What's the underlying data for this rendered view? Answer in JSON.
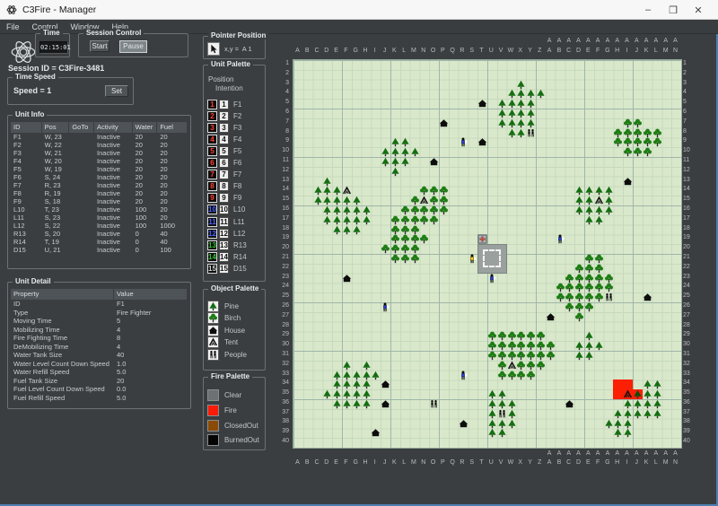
{
  "window": {
    "title": "C3Fire - Manager",
    "minimize": "–",
    "maximize": "❒",
    "close": "✕"
  },
  "menu": {
    "items": [
      "File",
      "Control",
      "Window",
      "Help"
    ]
  },
  "left": {
    "time": {
      "title": "Time",
      "value": "02:15:01"
    },
    "session_control": {
      "title": "Session Control",
      "start": "Start",
      "pause": "Pause"
    },
    "session_id": "Session ID = C3Fire-3481",
    "time_speed": {
      "title": "Time Speed",
      "label": "Speed = 1",
      "set": "Set"
    },
    "unit_info": {
      "title": "Unit Info",
      "columns": [
        "ID",
        "Pos",
        "GoTo",
        "Activity",
        "Water",
        "Fuel"
      ],
      "rows": [
        [
          "F1",
          "W, 23",
          "",
          "Inactive",
          "20",
          "20"
        ],
        [
          "F2",
          "W, 22",
          "",
          "Inactive",
          "20",
          "20"
        ],
        [
          "F3",
          "W, 21",
          "",
          "Inactive",
          "20",
          "20"
        ],
        [
          "F4",
          "W, 20",
          "",
          "Inactive",
          "20",
          "20"
        ],
        [
          "F5",
          "W, 19",
          "",
          "Inactive",
          "20",
          "20"
        ],
        [
          "F6",
          "S, 24",
          "",
          "Inactive",
          "20",
          "20"
        ],
        [
          "F7",
          "R, 23",
          "",
          "Inactive",
          "20",
          "20"
        ],
        [
          "F8",
          "R, 19",
          "",
          "Inactive",
          "20",
          "20"
        ],
        [
          "F9",
          "S, 18",
          "",
          "Inactive",
          "20",
          "20"
        ],
        [
          "L10",
          "T, 23",
          "",
          "Inactive",
          "100",
          "20"
        ],
        [
          "L11",
          "S, 23",
          "",
          "Inactive",
          "100",
          "20"
        ],
        [
          "L12",
          "S, 22",
          "",
          "Inactive",
          "100",
          "1000"
        ],
        [
          "R13",
          "S, 20",
          "",
          "Inactive",
          "0",
          "40"
        ],
        [
          "R14",
          "T, 19",
          "",
          "Inactive",
          "0",
          "40"
        ],
        [
          "D15",
          "U, 21",
          "",
          "Inactive",
          "0",
          "100"
        ]
      ]
    },
    "unit_detail": {
      "title": "Unit Detail",
      "columns": [
        "Property",
        "Value"
      ],
      "rows": [
        [
          "ID",
          "F1"
        ],
        [
          "Type",
          "Fire Fighter"
        ],
        [
          "Moving Time",
          "5"
        ],
        [
          "Mobilizing Time",
          "4"
        ],
        [
          "Fire Fighting Time",
          "8"
        ],
        [
          "DeMobilizing Time",
          "4"
        ],
        [
          "Water Tank Size",
          "40"
        ],
        [
          "Water Level Count Down Speed",
          "1.0"
        ],
        [
          "Water Refill Speed",
          "5.0"
        ],
        [
          "Fuel Tank Size",
          "20"
        ],
        [
          "Fuel Level Count Down Speed",
          "0.0"
        ],
        [
          "Fuel Refill Speed",
          "5.0"
        ]
      ]
    }
  },
  "middle": {
    "pointer": {
      "title": "Pointer Position",
      "value": "x,y =  A 1"
    },
    "unit_palette": {
      "title": "Unit Palette",
      "position_label": "Position",
      "intention_label": "Intention",
      "units": [
        {
          "num": "1",
          "label": "F1",
          "color": "#ff4033"
        },
        {
          "num": "2",
          "label": "F2",
          "color": "#ff4033"
        },
        {
          "num": "3",
          "label": "F3",
          "color": "#ff4033"
        },
        {
          "num": "4",
          "label": "F4",
          "color": "#ff4033"
        },
        {
          "num": "5",
          "label": "F5",
          "color": "#ff4033"
        },
        {
          "num": "6",
          "label": "F6",
          "color": "#ff4033"
        },
        {
          "num": "7",
          "label": "F7",
          "color": "#ff4033"
        },
        {
          "num": "8",
          "label": "F8",
          "color": "#ff4033"
        },
        {
          "num": "9",
          "label": "F9",
          "color": "#ff4033"
        },
        {
          "num": "10",
          "label": "L10",
          "color": "#4a63ff"
        },
        {
          "num": "11",
          "label": "L11",
          "color": "#4a63ff"
        },
        {
          "num": "12",
          "label": "L12",
          "color": "#4a63ff"
        },
        {
          "num": "13",
          "label": "R13",
          "color": "#35c335"
        },
        {
          "num": "14",
          "label": "R14",
          "color": "#35c335"
        },
        {
          "num": "15",
          "label": "D15",
          "color": "#cfd3d4"
        }
      ]
    },
    "object_palette": {
      "title": "Object Palette",
      "items": [
        {
          "icon": "pine",
          "label": "Pine"
        },
        {
          "icon": "birch",
          "label": "Birch"
        },
        {
          "icon": "house",
          "label": "House"
        },
        {
          "icon": "tent",
          "label": "Tent"
        },
        {
          "icon": "people",
          "label": "People"
        }
      ]
    },
    "fire_palette": {
      "title": "Fire Palette",
      "items": [
        {
          "label": "Clear",
          "color": "#6e7173"
        },
        {
          "label": "Fire",
          "color": "#fb1b07"
        },
        {
          "label": "ClosedOut",
          "color": "#8a4a08"
        },
        {
          "label": "BurnedOut",
          "color": "#040404"
        }
      ]
    }
  },
  "map": {
    "cols": 40,
    "rows": 40,
    "col_letters": [
      "A",
      "B",
      "C",
      "D",
      "E",
      "F",
      "G",
      "H",
      "I",
      "J",
      "K",
      "L",
      "M",
      "N",
      "O",
      "P",
      "Q",
      "R",
      "S",
      "T",
      "U",
      "V",
      "W",
      "X",
      "Y",
      "Z",
      "A",
      "B",
      "C",
      "D",
      "E",
      "F",
      "G",
      "H",
      "I",
      "J",
      "K",
      "L",
      "M",
      "N"
    ],
    "second_alphabet_prefix": "A",
    "second_alphabet_from": 27,
    "colors": {
      "bg": "#d9e8cb",
      "grid_minor": "#c6dabd",
      "grid_major": "#9fb6a8",
      "fire": "#fb1f03",
      "pine_green": "#156e12",
      "birch_green": "#1e7d14"
    },
    "pine": [
      [
        11,
        9
      ],
      [
        12,
        9
      ],
      [
        10,
        10
      ],
      [
        11,
        10
      ],
      [
        12,
        10
      ],
      [
        13,
        10
      ],
      [
        10,
        11
      ],
      [
        11,
        11
      ],
      [
        12,
        11
      ],
      [
        11,
        12
      ],
      [
        4,
        13
      ],
      [
        3,
        14
      ],
      [
        4,
        14
      ],
      [
        5,
        14
      ],
      [
        3,
        15
      ],
      [
        4,
        15
      ],
      [
        5,
        15
      ],
      [
        6,
        15
      ],
      [
        7,
        15
      ],
      [
        4,
        16
      ],
      [
        5,
        16
      ],
      [
        6,
        16
      ],
      [
        7,
        16
      ],
      [
        8,
        16
      ],
      [
        4,
        17
      ],
      [
        5,
        17
      ],
      [
        6,
        17
      ],
      [
        7,
        17
      ],
      [
        8,
        17
      ],
      [
        5,
        18
      ],
      [
        6,
        18
      ],
      [
        7,
        18
      ],
      [
        24,
        3
      ],
      [
        23,
        4
      ],
      [
        24,
        4
      ],
      [
        25,
        4
      ],
      [
        26,
        4
      ],
      [
        22,
        5
      ],
      [
        23,
        5
      ],
      [
        24,
        5
      ],
      [
        25,
        5
      ],
      [
        22,
        6
      ],
      [
        23,
        6
      ],
      [
        24,
        6
      ],
      [
        25,
        6
      ],
      [
        22,
        7
      ],
      [
        23,
        7
      ],
      [
        24,
        7
      ],
      [
        25,
        7
      ],
      [
        23,
        8
      ],
      [
        24,
        8
      ],
      [
        30,
        14
      ],
      [
        31,
        14
      ],
      [
        32,
        14
      ],
      [
        33,
        14
      ],
      [
        30,
        15
      ],
      [
        31,
        15
      ],
      [
        33,
        15
      ],
      [
        30,
        16
      ],
      [
        31,
        16
      ],
      [
        32,
        16
      ],
      [
        33,
        16
      ],
      [
        31,
        17
      ],
      [
        32,
        17
      ],
      [
        31,
        29
      ],
      [
        30,
        30
      ],
      [
        31,
        30
      ],
      [
        32,
        30
      ],
      [
        30,
        31
      ],
      [
        31,
        31
      ],
      [
        6,
        32
      ],
      [
        8,
        32
      ],
      [
        5,
        33
      ],
      [
        6,
        33
      ],
      [
        7,
        33
      ],
      [
        8,
        33
      ],
      [
        9,
        33
      ],
      [
        5,
        34
      ],
      [
        6,
        34
      ],
      [
        7,
        34
      ],
      [
        8,
        34
      ],
      [
        4,
        35
      ],
      [
        5,
        35
      ],
      [
        6,
        35
      ],
      [
        7,
        35
      ],
      [
        8,
        35
      ],
      [
        5,
        36
      ],
      [
        6,
        36
      ],
      [
        7,
        36
      ],
      [
        8,
        36
      ],
      [
        21,
        35
      ],
      [
        22,
        35
      ],
      [
        21,
        36
      ],
      [
        22,
        36
      ],
      [
        23,
        36
      ],
      [
        21,
        37
      ],
      [
        23,
        37
      ],
      [
        21,
        38
      ],
      [
        22,
        38
      ],
      [
        23,
        38
      ],
      [
        21,
        39
      ],
      [
        22,
        39
      ],
      [
        37,
        34
      ],
      [
        38,
        34
      ],
      [
        37,
        35
      ],
      [
        38,
        35
      ],
      [
        35,
        36
      ],
      [
        36,
        36
      ],
      [
        37,
        36
      ],
      [
        38,
        36
      ],
      [
        34,
        37
      ],
      [
        35,
        37
      ],
      [
        36,
        37
      ],
      [
        37,
        37
      ],
      [
        38,
        37
      ],
      [
        33,
        38
      ],
      [
        34,
        38
      ],
      [
        35,
        38
      ],
      [
        34,
        39
      ],
      [
        35,
        39
      ]
    ],
    "birch": [
      [
        14,
        14
      ],
      [
        15,
        14
      ],
      [
        16,
        14
      ],
      [
        13,
        15
      ],
      [
        15,
        15
      ],
      [
        16,
        15
      ],
      [
        12,
        16
      ],
      [
        13,
        16
      ],
      [
        14,
        16
      ],
      [
        15,
        16
      ],
      [
        16,
        16
      ],
      [
        11,
        17
      ],
      [
        12,
        17
      ],
      [
        13,
        17
      ],
      [
        14,
        17
      ],
      [
        15,
        17
      ],
      [
        11,
        18
      ],
      [
        12,
        18
      ],
      [
        13,
        18
      ],
      [
        11,
        19
      ],
      [
        12,
        19
      ],
      [
        13,
        19
      ],
      [
        14,
        19
      ],
      [
        10,
        20
      ],
      [
        11,
        20
      ],
      [
        12,
        20
      ],
      [
        13,
        20
      ],
      [
        11,
        21
      ],
      [
        12,
        21
      ],
      [
        13,
        21
      ],
      [
        35,
        7
      ],
      [
        36,
        7
      ],
      [
        34,
        8
      ],
      [
        35,
        8
      ],
      [
        36,
        8
      ],
      [
        37,
        8
      ],
      [
        38,
        8
      ],
      [
        34,
        9
      ],
      [
        35,
        9
      ],
      [
        36,
        9
      ],
      [
        37,
        9
      ],
      [
        38,
        9
      ],
      [
        35,
        10
      ],
      [
        36,
        10
      ],
      [
        37,
        10
      ],
      [
        31,
        21
      ],
      [
        32,
        21
      ],
      [
        30,
        22
      ],
      [
        31,
        22
      ],
      [
        32,
        22
      ],
      [
        29,
        23
      ],
      [
        30,
        23
      ],
      [
        31,
        23
      ],
      [
        32,
        23
      ],
      [
        33,
        23
      ],
      [
        28,
        24
      ],
      [
        29,
        24
      ],
      [
        30,
        24
      ],
      [
        31,
        24
      ],
      [
        32,
        24
      ],
      [
        33,
        24
      ],
      [
        28,
        25
      ],
      [
        29,
        25
      ],
      [
        30,
        25
      ],
      [
        31,
        25
      ],
      [
        32,
        25
      ],
      [
        29,
        26
      ],
      [
        30,
        26
      ],
      [
        31,
        26
      ],
      [
        30,
        27
      ],
      [
        21,
        29
      ],
      [
        22,
        29
      ],
      [
        23,
        29
      ],
      [
        24,
        29
      ],
      [
        25,
        29
      ],
      [
        26,
        29
      ],
      [
        21,
        30
      ],
      [
        22,
        30
      ],
      [
        23,
        30
      ],
      [
        24,
        30
      ],
      [
        25,
        30
      ],
      [
        26,
        30
      ],
      [
        27,
        30
      ],
      [
        21,
        31
      ],
      [
        22,
        31
      ],
      [
        23,
        31
      ],
      [
        24,
        31
      ],
      [
        25,
        31
      ],
      [
        26,
        31
      ],
      [
        27,
        31
      ],
      [
        22,
        32
      ],
      [
        24,
        32
      ],
      [
        25,
        32
      ],
      [
        26,
        32
      ],
      [
        22,
        33
      ],
      [
        23,
        33
      ],
      [
        24,
        33
      ],
      [
        25,
        33
      ]
    ],
    "house": [
      [
        20,
        5
      ],
      [
        16,
        7
      ],
      [
        20,
        9
      ],
      [
        15,
        11
      ],
      [
        35,
        13
      ],
      [
        6,
        23
      ],
      [
        37,
        25
      ],
      [
        27,
        27
      ],
      [
        10,
        34
      ],
      [
        10,
        36
      ],
      [
        29,
        36
      ],
      [
        18,
        38
      ],
      [
        9,
        39
      ]
    ],
    "tent": [
      [
        6,
        14
      ],
      [
        14,
        15
      ],
      [
        32,
        15
      ],
      [
        23,
        32
      ]
    ],
    "people": [
      [
        25,
        8
      ],
      [
        33,
        25
      ],
      [
        15,
        36
      ],
      [
        22,
        37
      ]
    ],
    "persons": [
      {
        "c": 18,
        "r": 9,
        "color": "#2742d6"
      },
      {
        "c": 28,
        "r": 19,
        "color": "#2742d6"
      },
      {
        "c": 19,
        "r": 21,
        "color": "#ffd400"
      },
      {
        "c": 21,
        "r": 23,
        "color": "#2742d6"
      },
      {
        "c": 10,
        "r": 26,
        "color": "#2742d6"
      },
      {
        "c": 18,
        "r": 33,
        "color": "#2742d6"
      }
    ],
    "fires": [
      {
        "c": 34,
        "r": 34
      },
      {
        "c": 35,
        "r": 34
      },
      {
        "c": 34,
        "r": 35
      },
      {
        "c": 35,
        "r": 35,
        "overlay": "tent"
      },
      {
        "c": 36,
        "r": 35,
        "overlay": "pine"
      }
    ],
    "station": {
      "c": 20,
      "r": 20,
      "w": 3,
      "h": 3
    },
    "station_icon": {
      "c": 20,
      "r": 19
    }
  }
}
